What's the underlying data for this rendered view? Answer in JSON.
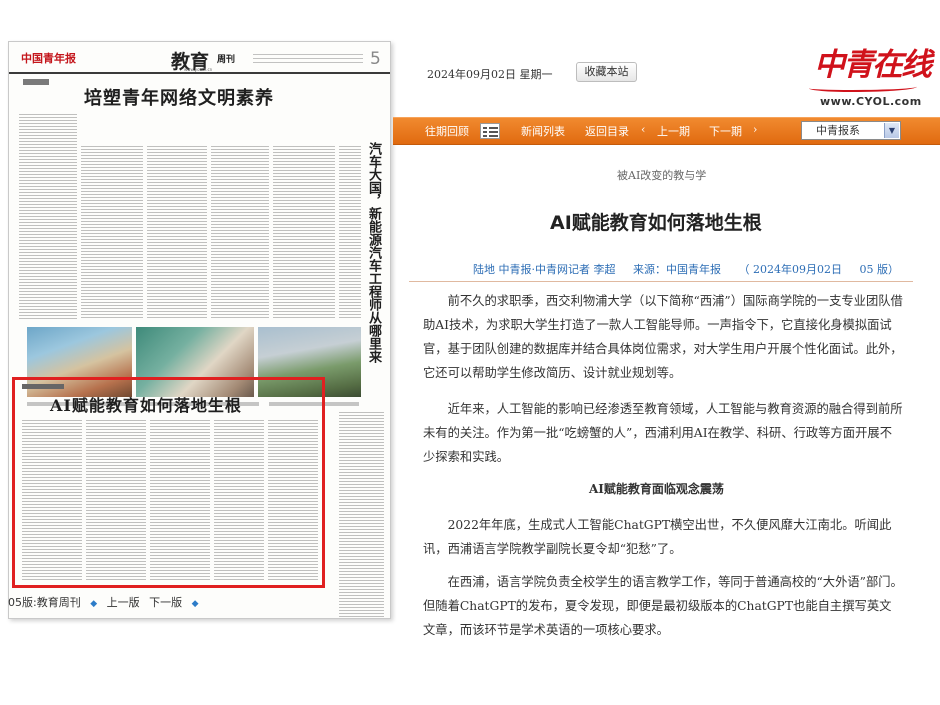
{
  "header": {
    "date": "2024年09月02日",
    "weekday": "星期一",
    "favorite_label": "收藏本站",
    "logo_text": "中青在线",
    "logo_url": "www.CYOL.com"
  },
  "nav": {
    "items": [
      "往期回顾",
      "新闻列表",
      "返回目录",
      "上一期",
      "下一期"
    ],
    "paper_select": "中青报系"
  },
  "newspaper": {
    "masthead": "中国青年报",
    "section": "教育",
    "section_sub": "周刊",
    "url": "www.youth.cn",
    "page_no": "5",
    "main_headline": "培塑青年网络文明素养",
    "vertical_headline": "汽车大国，新能源汽车工程师从哪里来",
    "ai_headline": "AI赋能教育如何落地生根",
    "footer": {
      "page_label": "05版:教育周刊",
      "prev": "上一版",
      "next": "下一版"
    }
  },
  "article": {
    "column": "被AI改变的教与学",
    "title": "AI赋能教育如何落地生根",
    "authors": "陆地 中青报·中青网记者 李超",
    "source": "来源：中国青年报",
    "date": "（ 2024年09月02日",
    "page": "05 版）",
    "paragraphs": [
      "前不久的求职季，西交利物浦大学（以下简称“西浦”）国际商学院的一支专业团队借助AI技术，为求职大学生打造了一款人工智能导师。一声指令下，它直接化身模拟面试官，基于团队创建的数据库并结合具体岗位需求，对大学生用户开展个性化面试。此外，它还可以帮助学生修改简历、设计就业规划等。",
      "近年来，人工智能的影响已经渗透至教育领域，人工智能与教育资源的融合得到前所未有的关注。作为第一批“吃螃蟹的人”，西浦利用AI在教学、科研、行政等方面开展不少探索和实践。",
      "2022年年底，生成式人工智能ChatGPT横空出世，不久便风靡大江南北。听闻此讯，西浦语言学院教学副院长夏令却“犯愁”了。",
      "在西浦，语言学院负责全校学生的语言教学工作，等同于普通高校的“大外语”部门。但随着ChatGPT的发布，夏令发现，即便是最初级版本的ChatGPT也能自主撰写英文文章，而该环节是学术英语的一项核心要求。"
    ],
    "section_heading": "AI赋能教育面临观念震荡"
  }
}
